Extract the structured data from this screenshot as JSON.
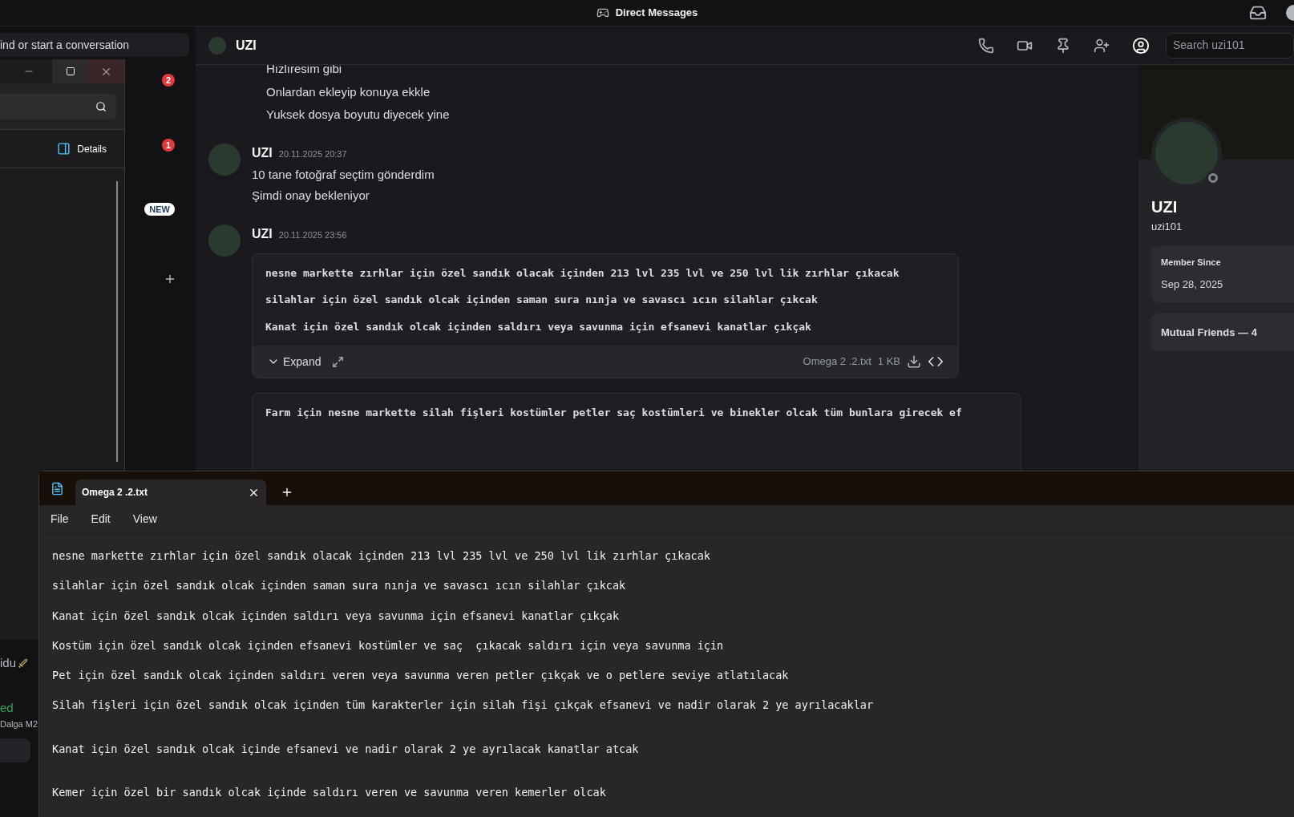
{
  "top_bar": {
    "title": "Direct Messages"
  },
  "dm_sidebar": {
    "search_placeholder": "ind or start a conversation",
    "badges": [
      {
        "kind": "count",
        "text": "2"
      },
      {
        "kind": "count",
        "text": "1"
      },
      {
        "kind": "new",
        "text": "NEW"
      }
    ]
  },
  "chat": {
    "header": {
      "name": "UZI",
      "search_placeholder": "Search uzi101"
    },
    "messages": [
      {
        "kind": "continuation",
        "lines": [
          "Hızlıresim gibi",
          "Onlardan ekleyip konuya ekkle",
          "Yuksek dosya boyutu diyecek yine"
        ]
      },
      {
        "kind": "group",
        "author": "UZI",
        "time": "20.11.2025 20:37",
        "lines": [
          "10 tane fotoğraf seçtim gönderdim",
          "Şimdi onay bekleniyor"
        ]
      },
      {
        "kind": "group",
        "author": "UZI",
        "time": "20.11.2025 23:56",
        "attachments": [
          {
            "kind": "file",
            "lines": [
              "nesne markette zırhlar için özel sandık olacak içinden 213 lvl 235 lvl ve 250 lvl lik zırhlar çıkacak",
              "silahlar için özel sandık olcak içinden saman sura nınja ve savascı ıcın silahlar çıkcak",
              "Kanat için özel sandık olcak içinden saldırı veya savunma için efsanevi kanatlar çıkçak"
            ],
            "expand_label": "Expand",
            "file_name": "Omega 2 .2.txt",
            "size": "1 KB"
          },
          {
            "kind": "preview",
            "lines": [
              "Farm için nesne markette silah fişleri kostümler petler saç kostümleri ve binekler olcak tüm bunlara girecek ef"
            ]
          }
        ]
      }
    ]
  },
  "profile": {
    "name": "UZI",
    "username": "uzi101",
    "member_since_label": "Member Since",
    "member_since": "Sep 28, 2025",
    "mutual_friends": "Mutual Friends — 4"
  },
  "back_window": {
    "details_label": "Details",
    "fragments": [
      {
        "kind": "name",
        "text": "idu"
      },
      {
        "kind": "status",
        "text": "ed"
      },
      {
        "kind": "sub",
        "text": "Dalga M2"
      }
    ]
  },
  "notepad": {
    "tab_title": "Omega 2 .2.txt",
    "menu": [
      "File",
      "Edit",
      "View"
    ],
    "lines": [
      {
        "text": "nesne markette zırhlar için özel sandık olacak içinden 213 lvl 235 lvl ve 250 lvl lik zırhlar çıkacak",
        "gap_before": false
      },
      {
        "text": "silahlar için özel sandık olcak içinden saman sura nınja ve savascı ıcın silahlar çıkcak",
        "gap_before": false
      },
      {
        "text": "Kanat için özel sandık olcak içinden saldırı veya savunma için efsanevi kanatlar çıkçak",
        "gap_before": false
      },
      {
        "text": "Kostüm için özel sandık olcak içinden efsanevi kostümler ve saç  çıkacak saldırı için veya savunma için",
        "gap_before": false
      },
      {
        "text": "Pet için özel sandık olcak içinden saldırı veren veya savunma veren petler çıkçak ve o petlere seviye atlatılacak",
        "gap_before": false
      },
      {
        "text": "Silah fişleri için özel sandık olcak içinden tüm karakterler için silah fişi çıkçak efsanevi ve nadir olarak 2 ye ayrılacaklar",
        "gap_before": false
      },
      {
        "text": "Kanat için özel sandık olcak içinde efsanevi ve nadir olarak 2 ye ayrılacak kanatlar atcak",
        "gap_before": true
      },
      {
        "text": "Kemer için özel bir sandık olcak içinde saldırı veren ve savunma veren kemerler olcak",
        "gap_before": true
      }
    ]
  }
}
